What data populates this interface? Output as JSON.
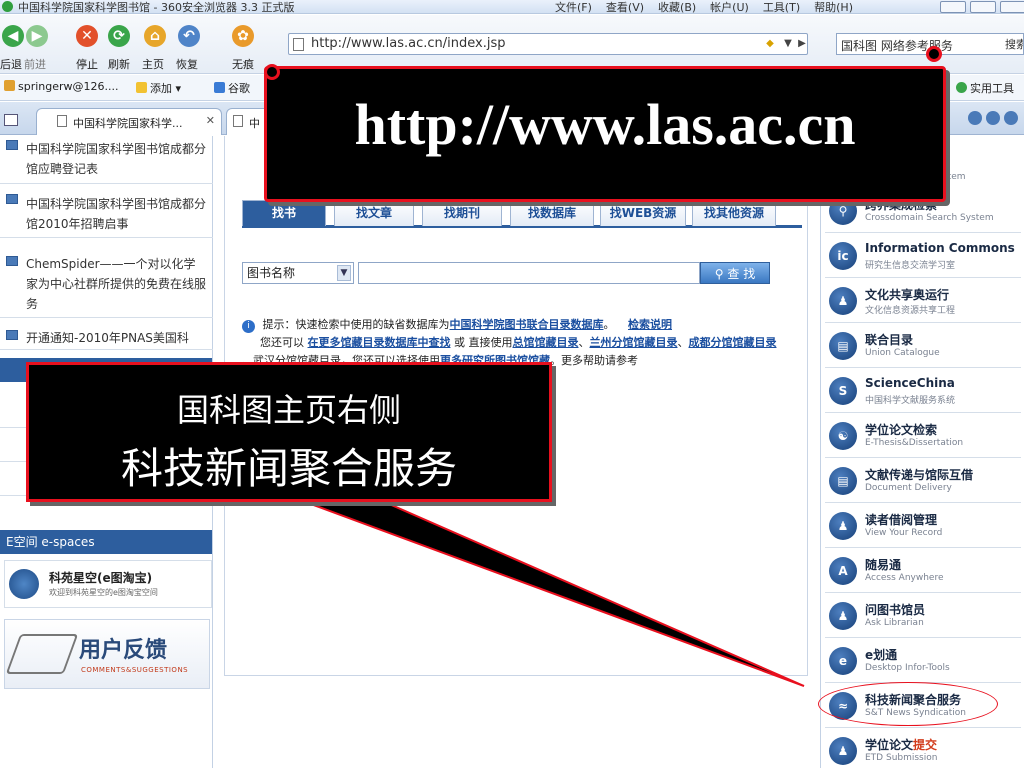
{
  "window": {
    "title": "中国科学院国家科学图书馆 - 360安全浏览器 3.3 正式版",
    "menus": [
      "文件(F)",
      "查看(V)",
      "收藏(B)",
      "帐户(U)",
      "工具(T)",
      "帮助(H)"
    ]
  },
  "toolbar": {
    "back_label": "后退",
    "forward_label": "前进",
    "stop_label": "停止",
    "refresh_label": "刷新",
    "home_label": "主页",
    "restore_label": "恢复",
    "incognito_label": "无痕",
    "url": "http://www.las.ac.cn/index.jsp",
    "search_engine_label": "国科图 网络参考服务",
    "search_go_label": "搜索"
  },
  "favorites": {
    "items": [
      "springerw@126....",
      "添加",
      "谷歌"
    ],
    "tools_label": "实用工具"
  },
  "tabs": [
    {
      "title": "中国科学院国家科学..."
    },
    {
      "title": "中"
    }
  ],
  "left": {
    "news": [
      "中国科学院国家科学图书馆成都分馆应聘登记表",
      "中国科学院国家科学图书馆成都分馆2010年招聘启事",
      "ChemSpider——一个对以化学家为中心社群所提供的免费在线服务",
      "开通通知-2010年PNAS美国科"
    ],
    "espaces_header": "E空间  e-spaces",
    "espace_item": {
      "name": "科苑星空(e图淘宝)",
      "sub": "欢迎到科苑星空的e图淘宝空间"
    },
    "feedback": {
      "title": "用户反馈",
      "sub": "COMMENTS&SUGGESTIONS"
    }
  },
  "center": {
    "tabs": [
      "找书",
      "找文章",
      "找期刊",
      "找数据库",
      "找WEB资源",
      "找其他资源"
    ],
    "field_select": "图书名称",
    "search_button": "查 找",
    "tip": {
      "prefix": "提示：快速检索中使用的缺省数据库为",
      "db_link": "中国科学院图书联合目录数据库",
      "help_link": "检索说明",
      "line2_prefix": "您还可以",
      "more_db_link": "在更多馆藏目录数据库中查找",
      "or_text": "或 直接使用",
      "main_catalog": "总馆馆藏目录",
      "lanzhou_catalog": "兰州分馆馆藏目录",
      "chengdu_catalog": "成都分馆馆藏目录",
      "line3_tail": "、武汉分馆馆藏目录，您还可以选择使用",
      "more_lib_link": "更多研究所图书馆馆藏",
      "more_help": "。更多帮助请参考"
    }
  },
  "right": {
    "top_partial_sub": "stem",
    "services": [
      {
        "title": "跨界集成检索",
        "sub": "Crossdomain Search System",
        "icon": "search-icon"
      },
      {
        "title": "Information Commons",
        "sub": "研究生信息交流学习室",
        "icon": "ic-logo-icon"
      },
      {
        "title": "文化共享奥运行",
        "sub": "文化信息资源共享工程",
        "icon": "person-icon"
      },
      {
        "title": "联合目录",
        "sub": "Union Catalogue",
        "icon": "catalog-icon"
      },
      {
        "title": "ScienceChina",
        "sub": "中国科学文献服务系统",
        "icon": "sciencechina-icon"
      },
      {
        "title": "学位论文检索",
        "sub": "E-Thesis&Dissertation",
        "icon": "thesis-icon"
      },
      {
        "title": "文献传递与馆际互借",
        "sub": "Document Delivery",
        "icon": "document-icon"
      },
      {
        "title": "读者借阅管理",
        "sub": "View Your Record",
        "icon": "reader-icon"
      },
      {
        "title": "随易通",
        "sub": "Access Anywhere",
        "icon": "access-icon"
      },
      {
        "title": "问图书馆员",
        "sub": "Ask Librarian",
        "icon": "librarian-icon"
      },
      {
        "title": "e划通",
        "sub": "Desktop Infor-Tools",
        "icon": "etool-icon"
      },
      {
        "title": "科技新闻聚合服务",
        "sub": "S&T News Syndication",
        "icon": "rss-icon"
      },
      {
        "title": "学位论文",
        "title_highlight": "提交",
        "sub": "ETD Submission",
        "icon": "submit-icon"
      }
    ]
  },
  "annotations": {
    "url_callout": "http://www.las.ac.cn",
    "note_line1": "国科图主页右侧",
    "note_line2": "科技新闻聚合服务",
    "accent_color": "#e8101e"
  }
}
